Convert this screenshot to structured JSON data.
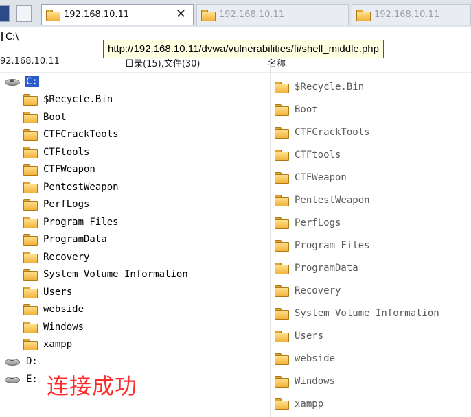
{
  "tabs": [
    {
      "label": "192.168.10.11",
      "active": true
    },
    {
      "label": "192.168.10.11",
      "active": false
    },
    {
      "label": "192.168.10.11",
      "active": false
    }
  ],
  "tab_close_glyph": "✕",
  "address": "C:\\",
  "tooltip": "http://192.168.10.11/dvwa/vulnerabilities/fi/shell_middle.php",
  "info": {
    "host": "92.168.10.11",
    "counts": "目录(15),文件(30)",
    "column_name": "名称"
  },
  "tree": {
    "drives": [
      {
        "label": "C:",
        "selected": true
      },
      {
        "label": "D:",
        "selected": false
      },
      {
        "label": "E:",
        "selected": false
      }
    ],
    "folders": [
      "$Recycle.Bin",
      "Boot",
      "CTFCrackTools",
      "CTFtools",
      "CTFWeapon",
      "PentestWeapon",
      "PerfLogs",
      "Program Files",
      "ProgramData",
      "Recovery",
      "System Volume Information",
      "Users",
      "webside",
      "Windows",
      "xampp"
    ]
  },
  "list": {
    "items": [
      "$Recycle.Bin",
      "Boot",
      "CTFCrackTools",
      "CTFtools",
      "CTFWeapon",
      "PentestWeapon",
      "PerfLogs",
      "Program Files",
      "ProgramData",
      "Recovery",
      "System Volume Information",
      "Users",
      "webside",
      "Windows",
      "xampp"
    ]
  },
  "status_overlay": "连接成功",
  "colors": {
    "selection": "#2c5ccc",
    "overlay_text": "#ff2b2b",
    "folder": "#f2b23c"
  },
  "icons": {
    "drive": "hard-drive-icon",
    "folder": "folder-icon",
    "close": "close-icon"
  }
}
